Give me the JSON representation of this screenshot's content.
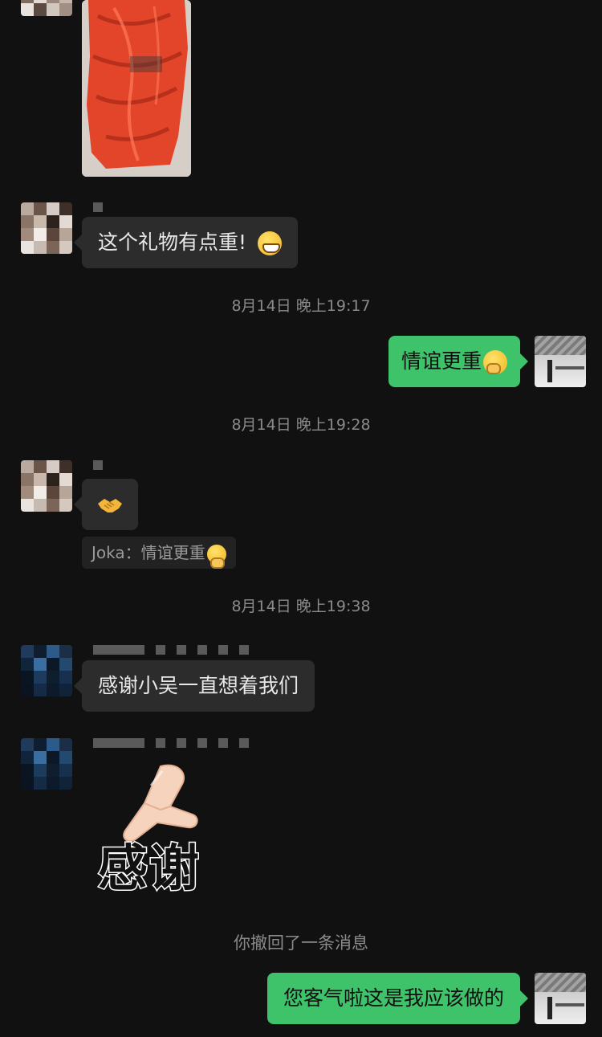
{
  "messages": {
    "m1": "这个礼物有点重!",
    "m2": "情谊更重",
    "m3_quote": "Joka：情谊更重",
    "m4": "感谢小吴一直想着我们",
    "sticker_text": "感谢",
    "m5": "您客气啦这是我应该做的"
  },
  "timestamps": {
    "t1": "8月14日 晚上19:17",
    "t2": "8月14日 晚上19:28",
    "t3": "8月14日 晚上19:38"
  },
  "system": {
    "recalled": "你撤回了一条消息"
  },
  "icons": {
    "grin": "grinning-face-emoji",
    "think": "thinking-face-emoji",
    "handshake": "handshake-emoji"
  },
  "colors": {
    "background": "#111111",
    "incoming_bubble": "#2c2c2c",
    "outgoing_bubble": "#3ec26a",
    "timestamp": "#8a8a8a"
  }
}
